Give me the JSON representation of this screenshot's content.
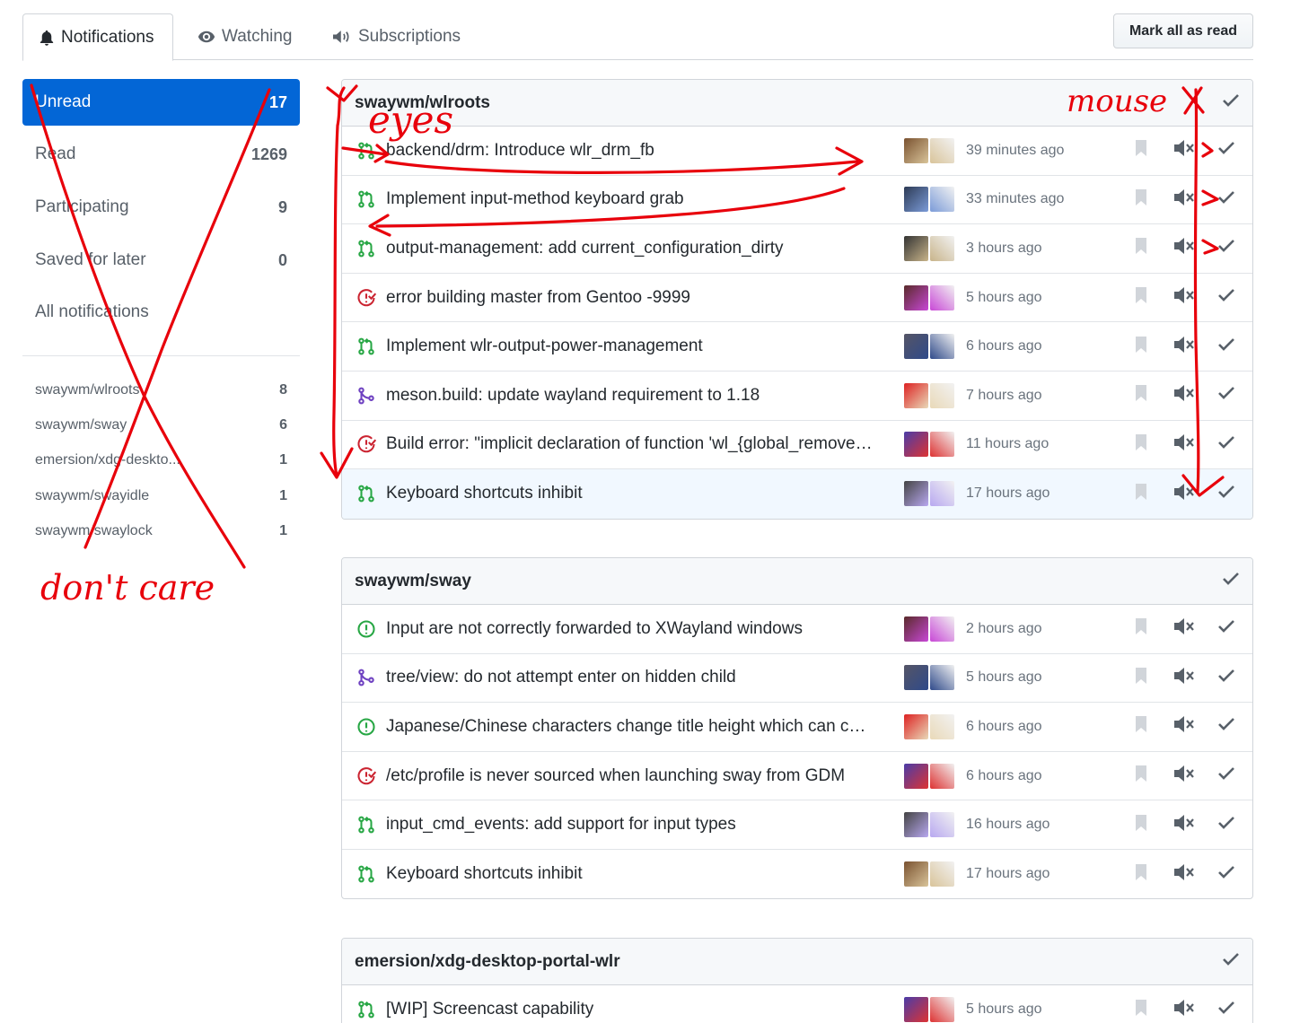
{
  "tabs": [
    {
      "label": "Notifications",
      "icon": "bell-icon"
    },
    {
      "label": "Watching",
      "icon": "eye-icon"
    },
    {
      "label": "Subscriptions",
      "icon": "broadcast-icon"
    }
  ],
  "mark_all_label": "Mark all as read",
  "sidebar": {
    "filters": [
      {
        "label": "Unread",
        "count": "17"
      },
      {
        "label": "Read",
        "count": "1269"
      },
      {
        "label": "Participating",
        "count": "9"
      },
      {
        "label": "Saved for later",
        "count": "0"
      },
      {
        "label": "All notifications",
        "count": ""
      }
    ],
    "repos": [
      {
        "label": "swaywm/wlroots",
        "count": "8"
      },
      {
        "label": "swaywm/sway",
        "count": "6"
      },
      {
        "label": "emersion/xdg-deskto...",
        "count": "1"
      },
      {
        "label": "swaywm/swayidle",
        "count": "1"
      },
      {
        "label": "swaywm/swaylock",
        "count": "1"
      }
    ]
  },
  "groups": [
    {
      "repo": "swaywm/wlroots",
      "items": [
        {
          "type": "pr",
          "title": "backend/drm: Introduce wlr_drm_fb",
          "time": "39 minutes ago"
        },
        {
          "type": "pr",
          "title": "Implement input-method keyboard grab",
          "time": "33 minutes ago"
        },
        {
          "type": "pr",
          "title": "output-management: add current_configuration_dirty",
          "time": "3 hours ago"
        },
        {
          "type": "issue-closed",
          "title": "error building master from Gentoo -9999",
          "time": "5 hours ago"
        },
        {
          "type": "pr",
          "title": "Implement wlr-output-power-management",
          "time": "6 hours ago"
        },
        {
          "type": "pr-merged",
          "title": "meson.build: update wayland requirement to 1.18",
          "time": "7 hours ago"
        },
        {
          "type": "issue-closed",
          "title": "Build error: \"implicit declaration of function 'wl_{global_remove…",
          "time": "11 hours ago"
        },
        {
          "type": "pr",
          "title": "Keyboard shortcuts inhibit",
          "time": "17 hours ago"
        }
      ]
    },
    {
      "repo": "swaywm/sway",
      "items": [
        {
          "type": "issue-open",
          "title": "Input are not correctly forwarded to XWayland windows",
          "time": "2 hours ago"
        },
        {
          "type": "pr-merged",
          "title": "tree/view: do not attempt enter on hidden child",
          "time": "5 hours ago"
        },
        {
          "type": "issue-open",
          "title": "Japanese/Chinese characters change title height which can c…",
          "time": "6 hours ago"
        },
        {
          "type": "issue-closed",
          "title": "/etc/profile is never sourced when launching sway from GDM",
          "time": "6 hours ago"
        },
        {
          "type": "pr",
          "title": "input_cmd_events: add support for input types",
          "time": "16 hours ago"
        },
        {
          "type": "pr",
          "title": "Keyboard shortcuts inhibit",
          "time": "17 hours ago"
        }
      ]
    },
    {
      "repo": "emersion/xdg-desktop-portal-wlr",
      "items": [
        {
          "type": "pr",
          "title": "[WIP] Screencast capability",
          "time": "5 hours ago"
        }
      ]
    }
  ],
  "annotations": {
    "eyes": "eyes",
    "mouse": "mouse",
    "dont_care": "don't care"
  },
  "colors": {
    "accent": "#0366d6",
    "pr_open": "#28a745",
    "merged": "#6f42c1",
    "closed": "#cb2431",
    "annotation": "#e8000b"
  }
}
